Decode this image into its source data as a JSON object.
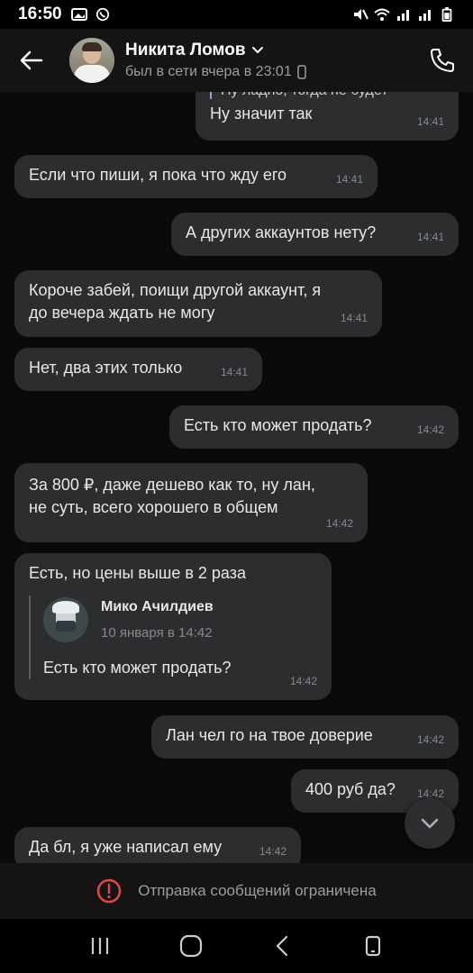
{
  "status_bar": {
    "time": "16:50"
  },
  "header": {
    "contact_name": "Никита Ломов",
    "last_seen": "был в сети вчера в 23:01"
  },
  "messages": [
    {
      "dir": "out",
      "text": "Ну значит так",
      "time": "14:41",
      "partial_text": "Ну ладно, тогда не будет"
    },
    {
      "dir": "in",
      "text": "Если что пиши, я пока что жду его",
      "time": "14:41"
    },
    {
      "dir": "out",
      "text": "А других аккаунтов нету?",
      "time": "14:41"
    },
    {
      "dir": "in",
      "text_line1": "Короче забей, поищи другой аккаунт, я",
      "text_line2": "до вечера ждать не могу",
      "time": "14:41"
    },
    {
      "dir": "in",
      "text": "Нет, два этих только",
      "time": "14:41"
    },
    {
      "dir": "out",
      "text": "Есть кто может продать?",
      "time": "14:42"
    },
    {
      "dir": "in",
      "text_line1": "За 800 ₽, даже дешево как то, ну лан,",
      "text_line2": "не суть, всего хорошего в общем",
      "time": "14:42"
    },
    {
      "dir": "in",
      "text": "Есть, но цены выше в 2 раза",
      "time": "14:42",
      "reply": {
        "author": "Мико Ачилдиев",
        "date": "10 января в 14:42",
        "text": "Есть кто может продать?"
      }
    },
    {
      "dir": "out",
      "text": "Лан чел го на твое доверие",
      "time": "14:42"
    },
    {
      "dir": "out",
      "text": "400 руб да?",
      "time": "14:42"
    },
    {
      "dir": "in",
      "text": "Да бл, я уже написал ему",
      "time": "14:42"
    }
  ],
  "composer": {
    "restricted_text": "Отправка сообщений ограничена"
  },
  "colors": {
    "bubble": "#2c2d2e",
    "background": "#0a0a0a",
    "header": "#141414",
    "alert_red": "#e64646"
  }
}
